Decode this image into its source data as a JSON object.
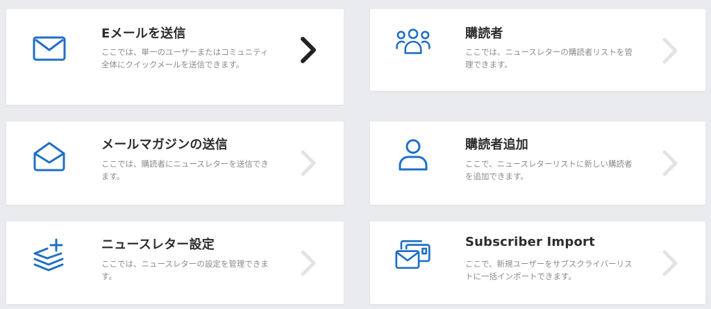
{
  "colors": {
    "background": "#e9ebee",
    "card": "#ffffff",
    "icon_blue": "#1f6fc5",
    "title": "#2d2d2d",
    "description": "#8a8a8a",
    "chevron_active": "#222222",
    "chevron_inactive": "#e3e3e3"
  },
  "cards": [
    {
      "icon": "envelope-icon",
      "title": "Eメールを送信",
      "description": "ここでは、単一のユーザーまたはコミュニティ全体にクイックメールを送信できます。",
      "active": true
    },
    {
      "icon": "users-group-icon",
      "title": "購読者",
      "description": "ここでは、ニュースレターの購読者リストを管理できます。",
      "active": false
    },
    {
      "icon": "envelope-open-icon",
      "title": "メールマガジンの送信",
      "description": "ここでは、購読者にニュースレターを送信できます。",
      "active": false
    },
    {
      "icon": "user-icon",
      "title": "購読者追加",
      "description": "ここで、ニュースレターリストに新しい購読者を追加できます。",
      "active": false
    },
    {
      "icon": "layers-plus-icon",
      "title": "ニュースレター設定",
      "description": "ここでは、ニュースレターの設定を管理できます。",
      "active": false
    },
    {
      "icon": "import-mail-icon",
      "title": "Subscriber Import",
      "description": "ここで、新規ユーザーをサブスクライバーリストに一括インポートできます。",
      "active": false
    }
  ]
}
